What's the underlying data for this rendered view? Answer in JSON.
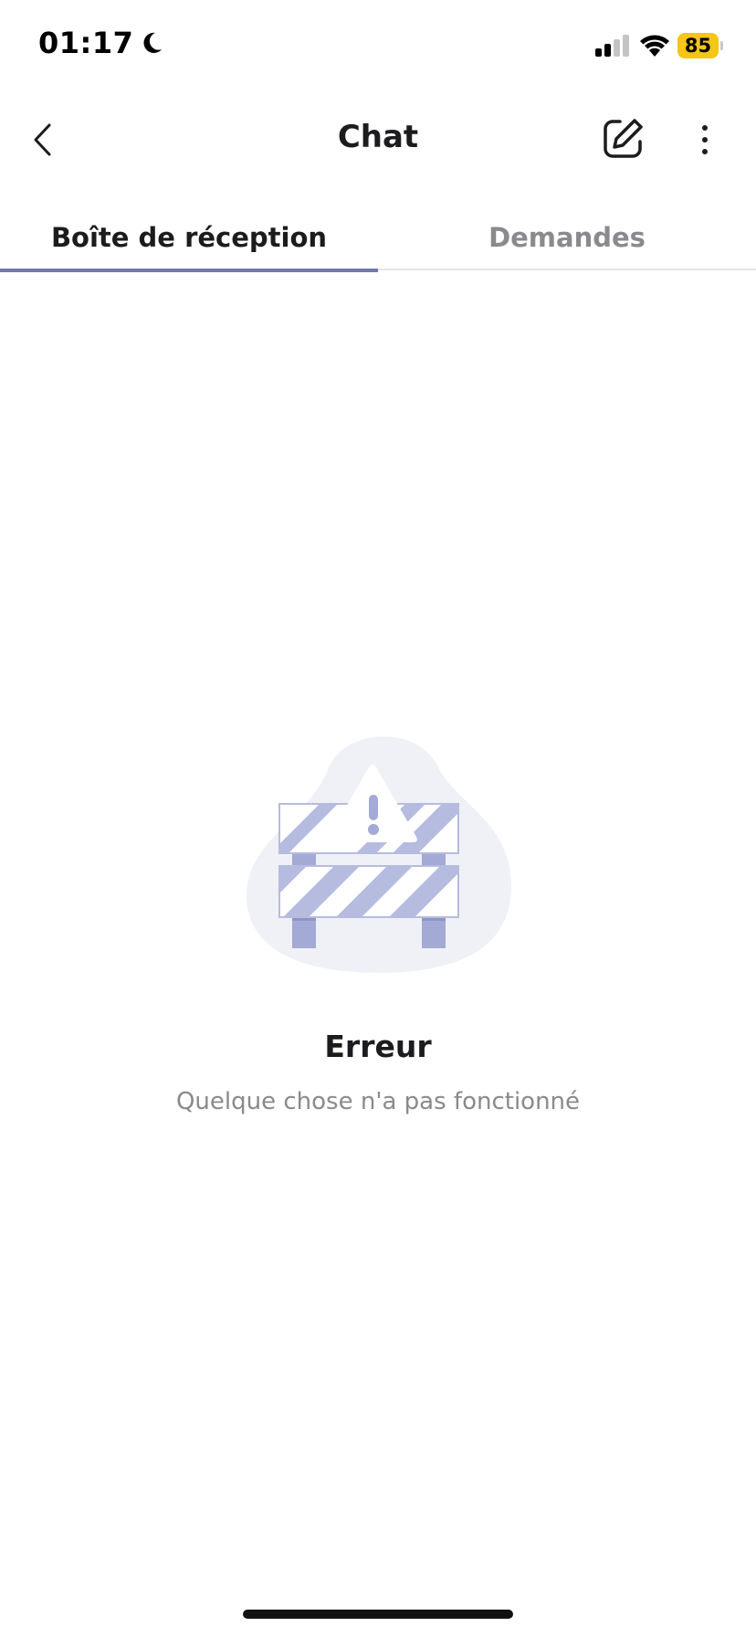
{
  "status_bar": {
    "time": "01:17",
    "battery_level": "85",
    "battery_color": "#f5c518",
    "icons": [
      "moon-icon",
      "signal-icon",
      "wifi-icon",
      "battery-icon"
    ]
  },
  "header": {
    "title": "Chat",
    "icons": [
      "back-chevron-icon",
      "compose-icon",
      "more-vertical-icon"
    ]
  },
  "tabs": [
    {
      "label": "Boîte de réception",
      "active": true
    },
    {
      "label": "Demandes",
      "active": false
    }
  ],
  "empty_state": {
    "illustration_icon": "barrier-warning-icon",
    "title": "Erreur",
    "message": "Quelque chose n'a pas fonctionné"
  },
  "colors": {
    "accent": "#7078ad",
    "illustration_stripe": "#b6bcdf",
    "illustration_bg": "#f0f1f6",
    "muted_text": "#8a8a8e"
  }
}
